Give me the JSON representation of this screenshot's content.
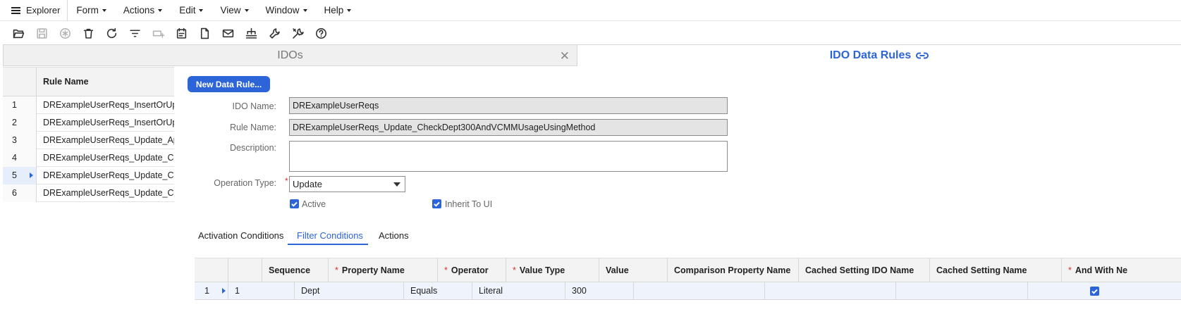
{
  "menubar": {
    "explorer": "Explorer",
    "items": [
      "Form",
      "Actions",
      "Edit",
      "View",
      "Window",
      "Help"
    ]
  },
  "toolbar": {
    "icons": [
      "open-folder-icon",
      "save-icon",
      "new-record-icon",
      "delete-icon",
      "refresh-icon",
      "filter-icon",
      "filter-in-place-icon",
      "calendar-icon",
      "document-icon",
      "mail-icon",
      "hierarchy-icon",
      "wrench-icon",
      "tools-icon",
      "help-icon"
    ]
  },
  "tabs": {
    "idos": "IDOs",
    "rules": "IDO Data Rules"
  },
  "rules_grid": {
    "header": "Rule Name",
    "rows": [
      {
        "num": "1",
        "name": "DRExampleUserReqs_InsertOrUp"
      },
      {
        "num": "2",
        "name": "DRExampleUserReqs_InsertOrUp"
      },
      {
        "num": "3",
        "name": "DRExampleUserReqs_Update_Ap"
      },
      {
        "num": "4",
        "name": "DRExampleUserReqs_Update_Ch"
      },
      {
        "num": "5",
        "name": "DRExampleUserReqs_Update_Ch"
      },
      {
        "num": "6",
        "name": "DRExampleUserReqs_Update_Ch"
      }
    ]
  },
  "form": {
    "new_button": "New Data Rule...",
    "ido_name_label": "IDO Name:",
    "ido_name_value": "DRExampleUserReqs",
    "rule_name_label": "Rule Name:",
    "rule_name_value": "DRExampleUserReqs_Update_CheckDept300AndVCMMUsageUsingMethod",
    "description_label": "Description:",
    "description_value": "",
    "operation_type_label": "Operation Type:",
    "operation_type_value": "Update",
    "required_mark": "*",
    "active_label": "Active",
    "inherit_label": "Inherit To UI"
  },
  "subtabs": [
    "Activation Conditions",
    "Filter Conditions",
    "Actions"
  ],
  "conditions_grid": {
    "headers": [
      {
        "label": "Sequence",
        "required": false
      },
      {
        "label": "Property Name",
        "required": true
      },
      {
        "label": "Operator",
        "required": true
      },
      {
        "label": "Value Type",
        "required": true
      },
      {
        "label": "Value",
        "required": false
      },
      {
        "label": "Comparison Property Name",
        "required": false
      },
      {
        "label": "Cached Setting IDO Name",
        "required": false
      },
      {
        "label": "Cached Setting Name",
        "required": false
      },
      {
        "label": "And With Ne",
        "required": true
      }
    ],
    "row": {
      "num": "1",
      "sequence": "1",
      "property_name": "Dept",
      "operator": "Equals",
      "value_type": "Literal",
      "value": "300",
      "comparison_property_name": "",
      "cached_setting_ido_name": "",
      "cached_setting_name": ""
    }
  }
}
